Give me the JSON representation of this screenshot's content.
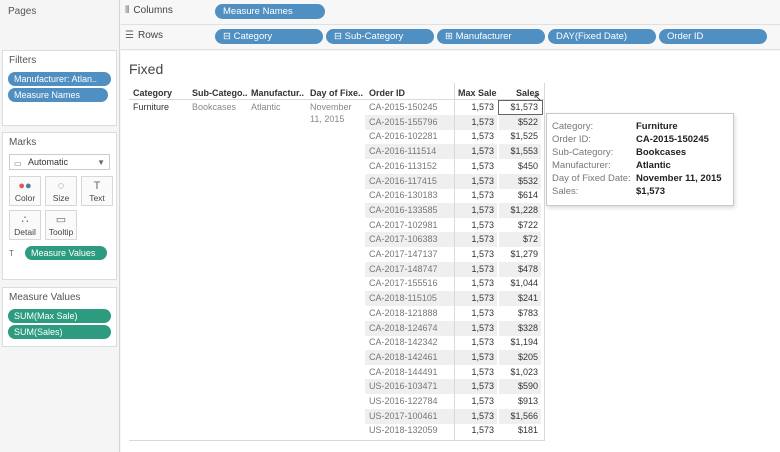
{
  "left_panel": {
    "pages": {
      "title": "Pages"
    },
    "filters": {
      "title": "Filters",
      "items": [
        "Manufacturer: Atlan..",
        "Measure Names"
      ]
    },
    "marks": {
      "title": "Marks",
      "type": "Automatic",
      "buttons": [
        {
          "label": "Color",
          "icon": "color-icon"
        },
        {
          "label": "Size",
          "icon": "size-icon"
        },
        {
          "label": "Text",
          "icon": "text-icon"
        },
        {
          "label": "Detail",
          "icon": "detail-icon"
        },
        {
          "label": "Tooltip",
          "icon": "tooltip-icon"
        }
      ],
      "text_pill": "Measure Values"
    },
    "measure_values": {
      "title": "Measure Values",
      "items": [
        "SUM(Max Sale)",
        "SUM(Sales)"
      ]
    }
  },
  "shelves": {
    "columns": {
      "label": "Columns",
      "pills": [
        "Measure Names"
      ]
    },
    "rows": {
      "label": "Rows",
      "pills": [
        "Category",
        "Sub-Category",
        "Manufacturer",
        "DAY(Fixed Date)",
        "Order ID"
      ]
    }
  },
  "view": {
    "title": "Fixed",
    "headers": {
      "category": "Category",
      "subcategory": "Sub-Catego..",
      "manufacturer": "Manufactur..",
      "day": "Day of Fixe..",
      "order_id": "Order ID",
      "max_sale": "Max Sale",
      "sales": "Sales"
    },
    "row_dims": {
      "category": "Furniture",
      "subcategory": "Bookcases",
      "manufacturer": "Atlantic",
      "day_line1": "November",
      "day_line2": "11, 2015"
    },
    "rows": [
      {
        "order_id": "CA-2015-150245",
        "max_sale": "1,573",
        "sales": "$1,573"
      },
      {
        "order_id": "CA-2015-155796",
        "max_sale": "1,573",
        "sales": "$522"
      },
      {
        "order_id": "CA-2016-102281",
        "max_sale": "1,573",
        "sales": "$1,525"
      },
      {
        "order_id": "CA-2016-111514",
        "max_sale": "1,573",
        "sales": "$1,553"
      },
      {
        "order_id": "CA-2016-113152",
        "max_sale": "1,573",
        "sales": "$450"
      },
      {
        "order_id": "CA-2016-117415",
        "max_sale": "1,573",
        "sales": "$532"
      },
      {
        "order_id": "CA-2016-130183",
        "max_sale": "1,573",
        "sales": "$614"
      },
      {
        "order_id": "CA-2016-133585",
        "max_sale": "1,573",
        "sales": "$1,228"
      },
      {
        "order_id": "CA-2017-102981",
        "max_sale": "1,573",
        "sales": "$722"
      },
      {
        "order_id": "CA-2017-106383",
        "max_sale": "1,573",
        "sales": "$72"
      },
      {
        "order_id": "CA-2017-147137",
        "max_sale": "1,573",
        "sales": "$1,279"
      },
      {
        "order_id": "CA-2017-148747",
        "max_sale": "1,573",
        "sales": "$478"
      },
      {
        "order_id": "CA-2017-155516",
        "max_sale": "1,573",
        "sales": "$1,044"
      },
      {
        "order_id": "CA-2018-115105",
        "max_sale": "1,573",
        "sales": "$241"
      },
      {
        "order_id": "CA-2018-121888",
        "max_sale": "1,573",
        "sales": "$783"
      },
      {
        "order_id": "CA-2018-124674",
        "max_sale": "1,573",
        "sales": "$328"
      },
      {
        "order_id": "CA-2018-142342",
        "max_sale": "1,573",
        "sales": "$1,194"
      },
      {
        "order_id": "CA-2018-142461",
        "max_sale": "1,573",
        "sales": "$205"
      },
      {
        "order_id": "CA-2018-144491",
        "max_sale": "1,573",
        "sales": "$1,023"
      },
      {
        "order_id": "US-2016-103471",
        "max_sale": "1,573",
        "sales": "$590"
      },
      {
        "order_id": "US-2016-122784",
        "max_sale": "1,573",
        "sales": "$913"
      },
      {
        "order_id": "US-2017-100461",
        "max_sale": "1,573",
        "sales": "$1,566"
      },
      {
        "order_id": "US-2018-132059",
        "max_sale": "1,573",
        "sales": "$181"
      }
    ]
  },
  "tooltip": [
    {
      "key": "Category:",
      "value": "Furniture"
    },
    {
      "key": "Order ID:",
      "value": "CA-2015-150245"
    },
    {
      "key": "Sub-Category:",
      "value": "Bookcases"
    },
    {
      "key": "Manufacturer:",
      "value": "Atlantic"
    },
    {
      "key": "Day of Fixed Date:",
      "value": "November 11, 2015"
    },
    {
      "key": "Sales:",
      "value": "$1,573"
    }
  ],
  "colors": {
    "dimension_pill": "#4f8fc1",
    "measure_pill": "#2c9b80",
    "row_shade": "#efefef"
  }
}
